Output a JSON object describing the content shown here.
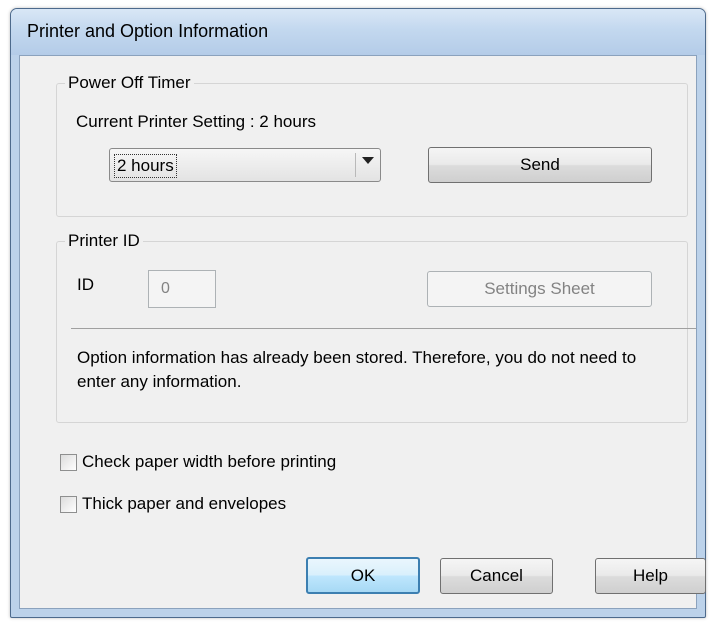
{
  "window": {
    "title": "Printer and Option Information"
  },
  "power_off_timer": {
    "group_label": "Power Off Timer",
    "current_setting": "Current Printer Setting : 2 hours",
    "selected_option": "2 hours",
    "send_button": "Send"
  },
  "printer_id": {
    "group_label": "Printer ID",
    "id_label": "ID",
    "id_value": "0",
    "settings_sheet_button": "Settings Sheet",
    "info_text": "Option information has already been stored. Therefore, you do not need to enter any information."
  },
  "options": {
    "check_paper_width": "Check paper width before printing",
    "check_paper_width_checked": false,
    "thick_paper": "Thick paper and envelopes",
    "thick_paper_checked": false
  },
  "buttons": {
    "ok": "OK",
    "cancel": "Cancel",
    "help": "Help"
  }
}
